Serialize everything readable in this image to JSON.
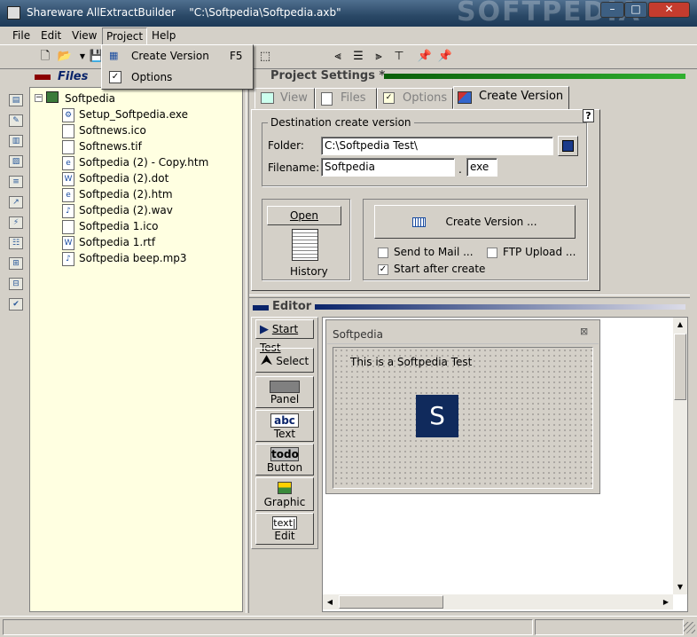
{
  "window": {
    "app_name": "Shareware AllExtractBuilder",
    "file_path": "\"C:\\Softpedia\\Softpedia.axb\"",
    "watermark": "SOFTPEDIA"
  },
  "menu": [
    "File",
    "Edit",
    "View",
    "Project",
    "Help"
  ],
  "project_menu": {
    "items": [
      {
        "label": "Create Version",
        "shortcut": "F5",
        "icon": "create-version-icon"
      },
      {
        "label": "Options",
        "shortcut": "",
        "icon": "options-icon"
      }
    ]
  },
  "files_panel": {
    "title": "Files",
    "root": "Softpedia",
    "files": [
      {
        "name": "Setup_Softpedia.exe",
        "icon": "setup-exe-icon"
      },
      {
        "name": "Softnews.ico",
        "icon": "blank-file-icon"
      },
      {
        "name": "Softnews.tif",
        "icon": "blank-file-icon"
      },
      {
        "name": "Softpedia (2) - Copy.htm",
        "icon": "ie-html-icon"
      },
      {
        "name": "Softpedia (2).dot",
        "icon": "word-doc-icon"
      },
      {
        "name": "Softpedia (2).htm",
        "icon": "ie-html-icon"
      },
      {
        "name": "Softpedia (2).wav",
        "icon": "audio-icon"
      },
      {
        "name": "Softpedia 1.ico",
        "icon": "blank-file-icon"
      },
      {
        "name": "Softpedia 1.rtf",
        "icon": "word-doc-icon"
      },
      {
        "name": "Softpedia beep.mp3",
        "icon": "audio-icon"
      }
    ]
  },
  "project_settings": {
    "title": "Project Settings *",
    "tabs": [
      "View",
      "Files",
      "Options",
      "Create Version"
    ],
    "active_tab": "Create Version",
    "group_title": "Destination create version",
    "help": "?",
    "folder_label": "Folder:",
    "folder_value": "C:\\Softpedia Test\\",
    "filename_label": "Filename:",
    "filename_value": "Softpedia",
    "dot": ".",
    "extension_value": "exe",
    "open_button": "Open",
    "history_label": "History",
    "create_button": "Create Version ...",
    "send_to_mail": "Send to Mail ...",
    "send_to_mail_checked": false,
    "ftp_upload": "FTP Upload ...",
    "ftp_upload_checked": false,
    "start_after_create": "Start after create",
    "start_after_create_checked": true
  },
  "editor": {
    "title": "Editor",
    "tools": {
      "start_test": "Start Test",
      "select": "Select",
      "panel": "Panel",
      "text": "Text",
      "text_icon": "abc",
      "button": "Button",
      "button_icon": "todo",
      "graphic": "Graphic",
      "edit": "Edit",
      "edit_icon": "text|"
    },
    "form": {
      "caption": "Softpedia",
      "close": "⊠",
      "label": "This is a Softpedia Test",
      "logo_letter": "S"
    }
  },
  "colors": {
    "files_bg": "#ffffe1",
    "accent_green": "#1a8a1a",
    "header_navy": "#0a246a"
  }
}
